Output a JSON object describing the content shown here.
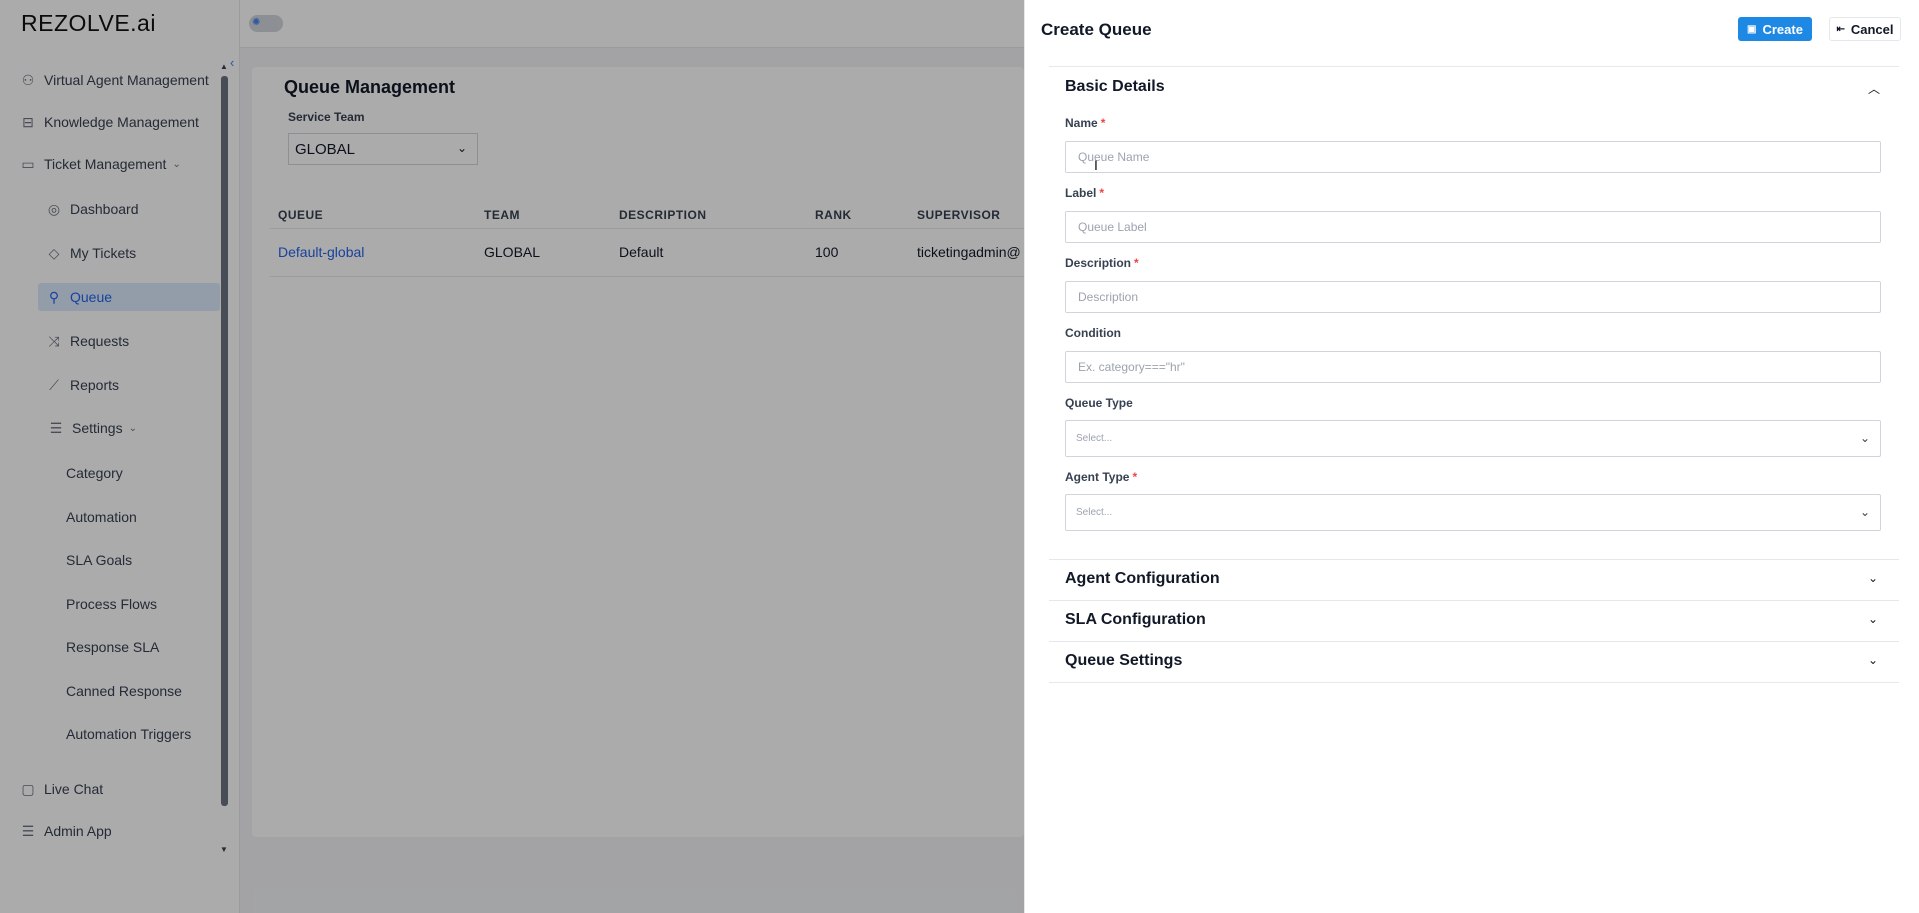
{
  "app": {
    "logo": "REZOLVE.ai"
  },
  "sidebar": {
    "items": [
      {
        "label": "Virtual Agent Management",
        "icon": "users-icon"
      },
      {
        "label": "Knowledge Management",
        "icon": "book-icon"
      },
      {
        "label": "Ticket Management",
        "icon": "ticket-icon"
      },
      {
        "label": "Dashboard",
        "icon": "dashboard-icon"
      },
      {
        "label": "My Tickets",
        "icon": "tag-icon"
      },
      {
        "label": "Queue",
        "icon": "user-plus-icon"
      },
      {
        "label": "Requests",
        "icon": "shuffle-icon"
      },
      {
        "label": "Reports",
        "icon": "chart-line-icon"
      },
      {
        "label": "Settings",
        "icon": "sliders-icon"
      },
      {
        "label": "Category"
      },
      {
        "label": "Automation"
      },
      {
        "label": "SLA Goals"
      },
      {
        "label": "Process Flows"
      },
      {
        "label": "Response SLA"
      },
      {
        "label": "Canned Response"
      },
      {
        "label": "Automation Triggers"
      },
      {
        "label": "Live Chat",
        "icon": "chat-icon"
      },
      {
        "label": "Admin App",
        "icon": "sliders-icon"
      }
    ]
  },
  "main": {
    "title": "Queue Management",
    "service_team_label": "Service Team",
    "service_team_value": "GLOBAL",
    "table": {
      "headers": [
        "QUEUE",
        "TEAM",
        "DESCRIPTION",
        "RANK",
        "SUPERVISOR"
      ],
      "rows": [
        {
          "queue": "Default-global",
          "team": "GLOBAL",
          "description": "Default",
          "rank": "100",
          "supervisor": "ticketingadmin@"
        }
      ]
    }
  },
  "drawer": {
    "title": "Create Queue",
    "create_label": "Create",
    "cancel_label": "Cancel",
    "basic_details": "Basic Details",
    "fields": {
      "name_label": "Name",
      "name_placeholder": "Queue Name",
      "label_label": "Label",
      "label_placeholder": "Queue Label",
      "description_label": "Description",
      "description_placeholder": "Description",
      "condition_label": "Condition",
      "condition_placeholder": "Ex. category===\"hr\"",
      "queue_type_label": "Queue Type",
      "queue_type_placeholder": "Select...",
      "agent_type_label": "Agent Type",
      "agent_type_placeholder": "Select...",
      "required_mark": "*"
    },
    "sections": [
      "Agent Configuration",
      "SLA Configuration",
      "Queue Settings"
    ]
  },
  "colors": {
    "primary": "#1e88e5",
    "link": "#2563eb",
    "required": "#ef4444",
    "active_bg": "#dbeafe"
  }
}
